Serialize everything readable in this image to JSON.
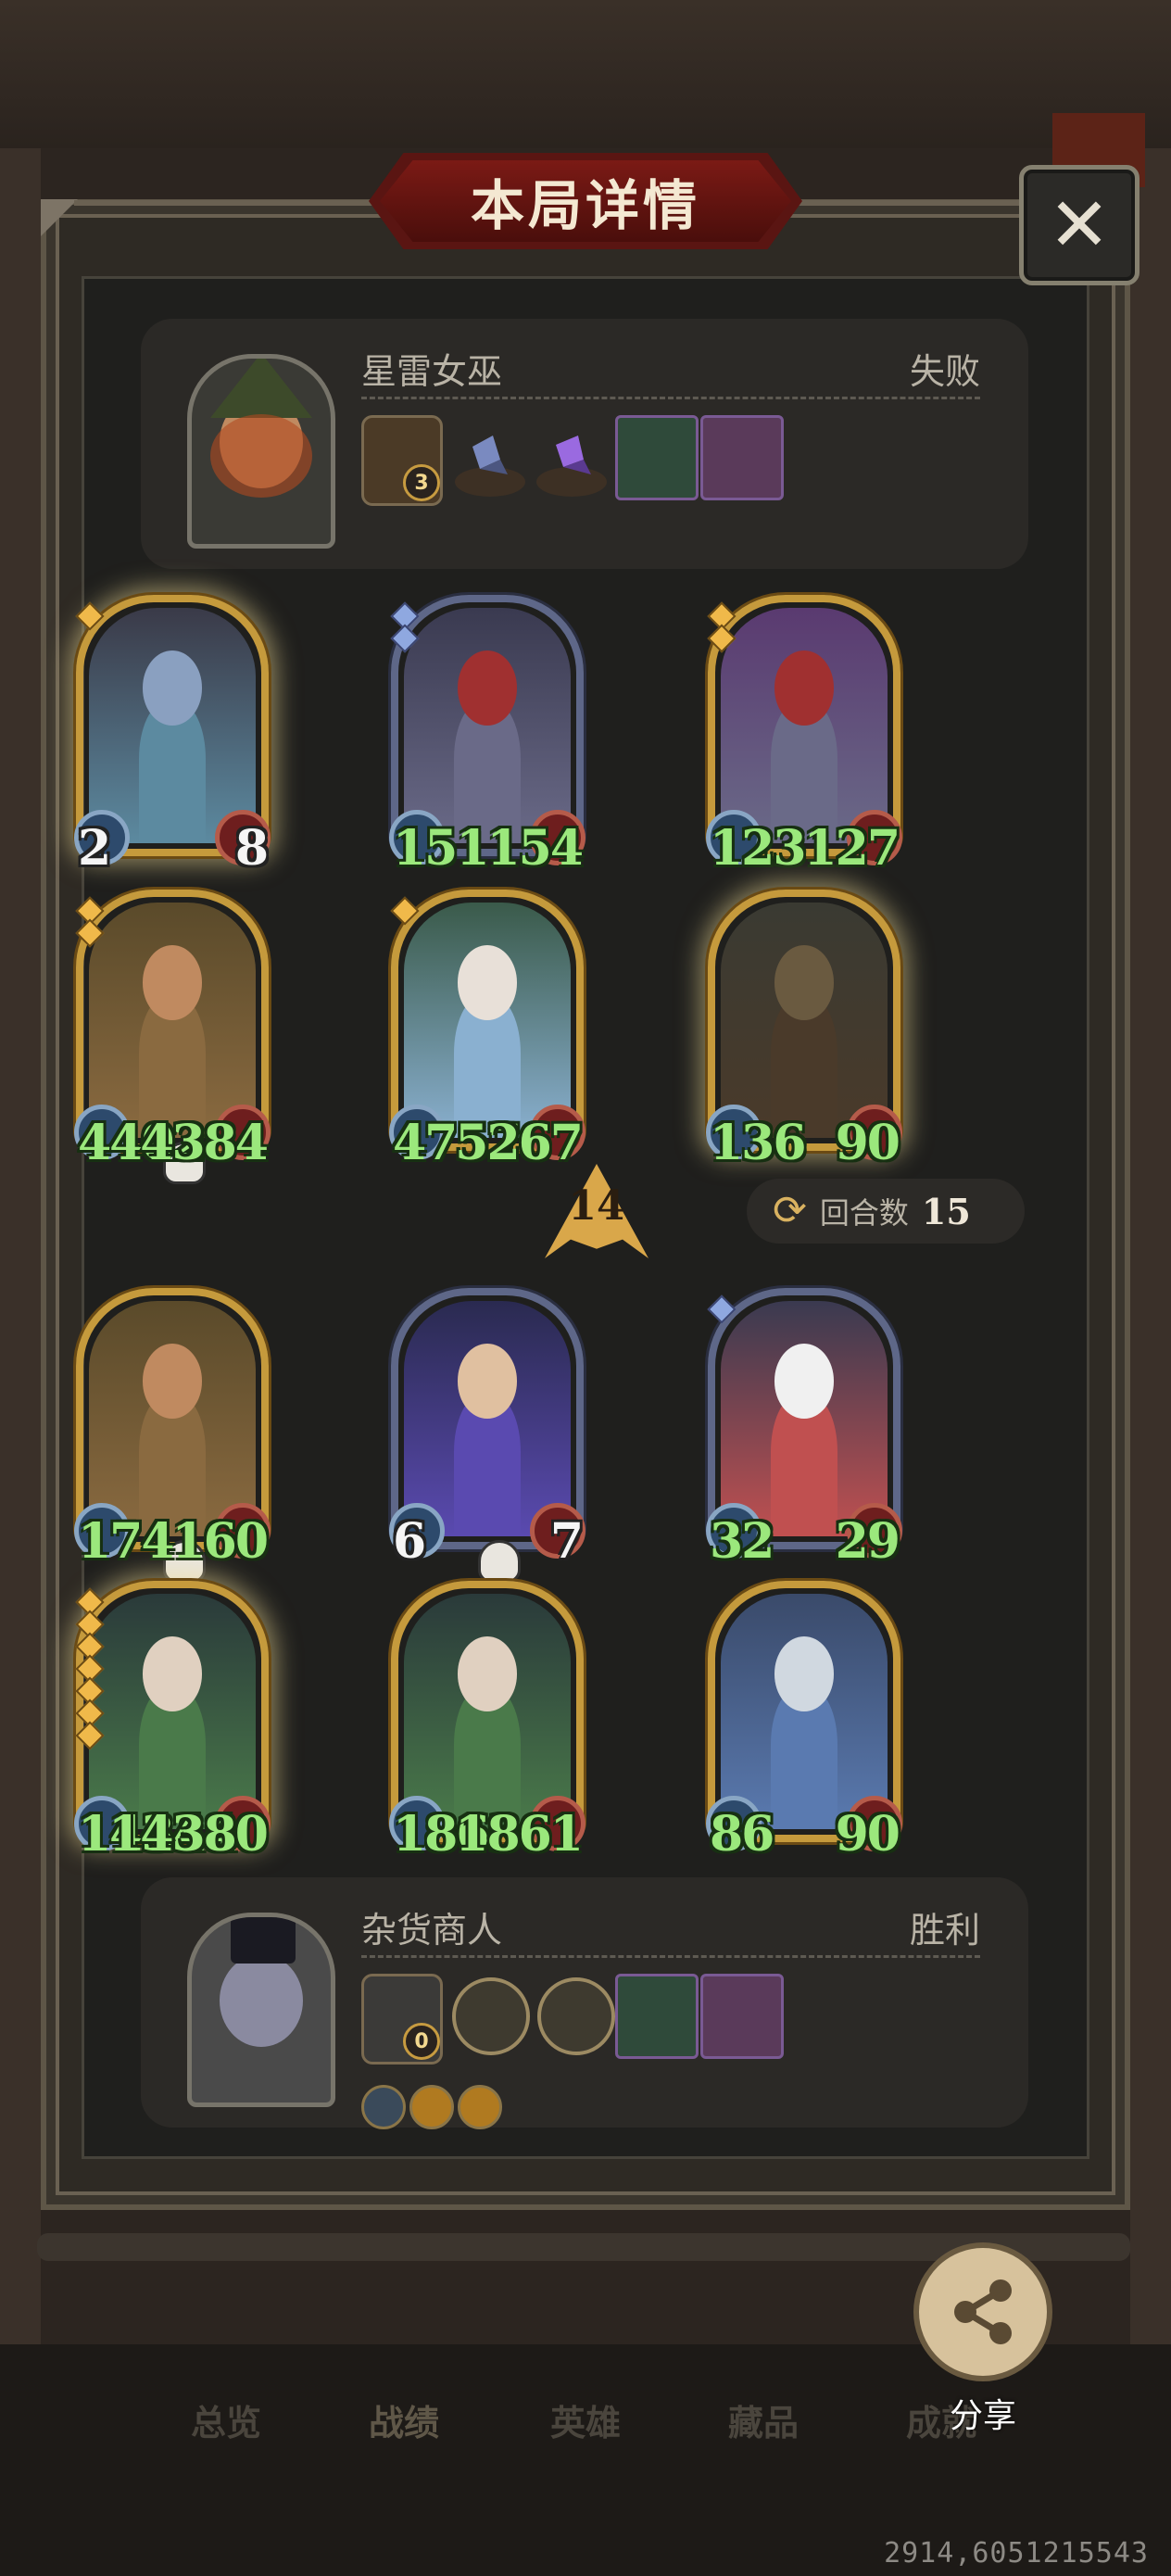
{
  "title": "本局详情",
  "player_top": {
    "name": "星雷女巫",
    "result": "失败",
    "relic_count": "3"
  },
  "player_bottom": {
    "name": "杂货商人",
    "result": "胜利",
    "relic_count": "0"
  },
  "enemy_cards": [
    {
      "atk": "2",
      "hp": "8",
      "atk_color": "white",
      "hp_color": "white",
      "stars": 1,
      "frame": "gold",
      "glow": true
    },
    {
      "atk": "151",
      "hp": "154",
      "atk_color": "green",
      "hp_color": "green",
      "stars": 2,
      "frame": "silver",
      "glow": false
    },
    {
      "atk": "123",
      "hp": "127",
      "atk_color": "green",
      "hp_color": "green",
      "stars": 2,
      "frame": "gold",
      "glow": false
    },
    {
      "atk": "4402",
      "hp": "4384",
      "atk_color": "green",
      "hp_color": "green",
      "stars": 2,
      "frame": "gold",
      "glow": false,
      "dead": true
    },
    {
      "atk": "4757",
      "hp": "5267",
      "atk_color": "green",
      "hp_color": "green",
      "stars": 1,
      "frame": "gold",
      "glow": false
    },
    {
      "atk": "136",
      "hp": "90",
      "atk_color": "green",
      "hp_color": "green",
      "stars": 0,
      "frame": "gold",
      "glow": true
    }
  ],
  "player_cards": [
    {
      "atk": "174",
      "hp": "160",
      "atk_color": "green",
      "hp_color": "green",
      "stars": 0,
      "frame": "gold",
      "glow": false,
      "dead": true
    },
    {
      "atk": "6",
      "hp": "7",
      "atk_color": "white",
      "hp_color": "white",
      "stars": 0,
      "frame": "silver",
      "glow": false,
      "dead": true
    },
    {
      "atk": "32",
      "hp": "29",
      "atk_color": "green",
      "hp_color": "green",
      "stars": 1,
      "frame": "silver",
      "glow": false
    },
    {
      "atk": "14344",
      "hp": "14380",
      "atk_color": "green",
      "hp_color": "green",
      "stars": 7,
      "frame": "gold",
      "glow": true
    },
    {
      "atk": "1863",
      "hp": "1861",
      "atk_color": "green",
      "hp_color": "green",
      "stars": 0,
      "frame": "gold",
      "glow": false
    },
    {
      "atk": "86",
      "hp": "90",
      "atk_color": "green",
      "hp_color": "green",
      "stars": 0,
      "frame": "gold",
      "glow": false
    }
  ],
  "turn_indicator": "14",
  "rounds": {
    "label": "回合数",
    "value": "15"
  },
  "nav": [
    "总览",
    "战绩",
    "英雄",
    "藏品",
    "成就"
  ],
  "nav_active": 1,
  "share_label": "分享",
  "coords": "2914,6051215543",
  "icons": {
    "close": "close-icon",
    "share": "share-icon",
    "rounds": "refresh-icon",
    "skull": "skull-icon"
  },
  "colors": {
    "stat_buffed": "#9be87c",
    "frame_gold": "#c59a3c",
    "frame_silver": "#5e6788",
    "banner": "#7b1a15"
  }
}
